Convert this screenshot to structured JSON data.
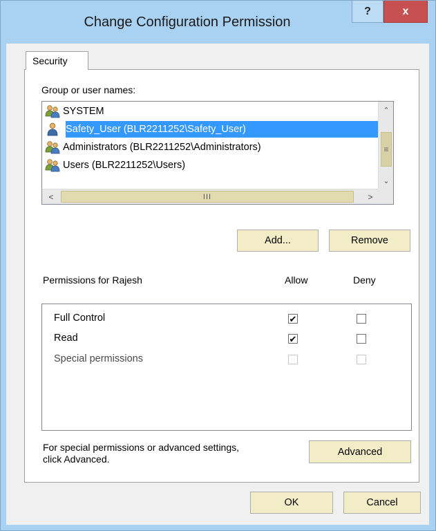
{
  "window": {
    "title": "Change Configuration Permission"
  },
  "titlebar_buttons": {
    "help": "?",
    "close": "x"
  },
  "tabs": [
    {
      "label": "Security"
    }
  ],
  "users": {
    "label": "Group or user names:",
    "items": [
      {
        "name": "SYSTEM",
        "icon": "group-icon",
        "selected": false
      },
      {
        "name": "Safety_User (BLR2211252\\Safety_User)",
        "icon": "user-icon",
        "selected": true
      },
      {
        "name": "Administrators (BLR2211252\\Administrators)",
        "icon": "group-icon",
        "selected": false
      },
      {
        "name": "Users (BLR2211252\\Users)",
        "icon": "group-icon",
        "selected": false
      }
    ],
    "hscroll_grip": "III"
  },
  "buttons": {
    "add": "Add...",
    "remove": "Remove",
    "advanced": "Advanced",
    "ok": "OK",
    "cancel": "Cancel"
  },
  "permissions": {
    "header": "Permissions for Rajesh",
    "allow_label": "Allow",
    "deny_label": "Deny",
    "rows": [
      {
        "label": "Full Control",
        "allow": true,
        "deny": false,
        "enabled": true
      },
      {
        "label": "Read",
        "allow": true,
        "deny": false,
        "enabled": true
      },
      {
        "label": "Special permissions",
        "allow": false,
        "deny": false,
        "enabled": false
      }
    ]
  },
  "advanced_text": {
    "line1": "For special permissions or advanced settings,",
    "line2": "click Advanced."
  },
  "colors": {
    "selection": "#3399ff",
    "button_face": "#f2ecc7",
    "frame": "#a9d1f2",
    "close": "#c75050"
  }
}
